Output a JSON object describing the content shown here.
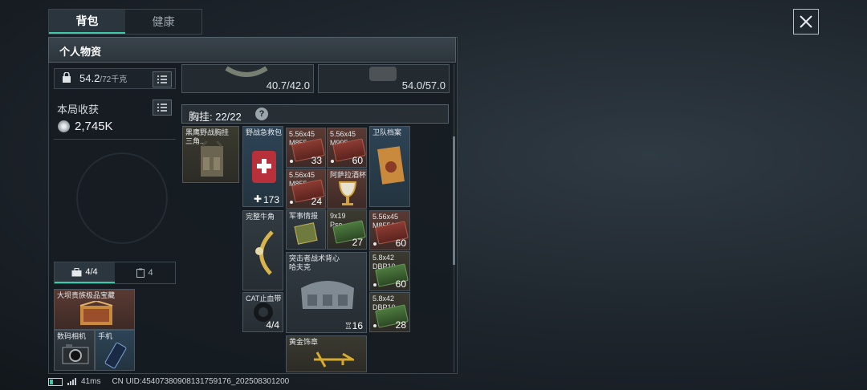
{
  "tabs": [
    {
      "label": "背包",
      "active": true
    },
    {
      "label": "健康",
      "active": false
    }
  ],
  "close_icon": "close-icon",
  "panel": {
    "title": "个人物资"
  },
  "left": {
    "weight_value": "54.2",
    "weight_max": "/72千克",
    "income_label": "本局收获",
    "income_value": "2,745K"
  },
  "bottom_tabs": [
    {
      "label": "4/4",
      "icon": "briefcase-icon",
      "active": true
    },
    {
      "label": "4",
      "icon": "clipboard-icon",
      "active": false
    }
  ],
  "secure_items": [
    {
      "name": "大坝贵族极品宝藏"
    },
    {
      "name": "数码相机"
    },
    {
      "name": "手机"
    }
  ],
  "equipment": [
    {
      "durability": "40.7/42.0"
    },
    {
      "durability": "54.0/57.0"
    }
  ],
  "rig": {
    "title": "胸挂: 22/22",
    "help": "?"
  },
  "items": {
    "rig_item": {
      "name": "黑鹰野战胸挂\n三角..."
    },
    "first_aid": {
      "name": "野战急救包",
      "count": "173"
    },
    "ammo1": {
      "name": "5.56x45\nM855",
      "count": "33"
    },
    "ammo2": {
      "name": "5.56x45\nM995",
      "count": "60"
    },
    "ammo3": {
      "name": "5.56x45\nM855",
      "count": "24"
    },
    "goblet": {
      "name": "阿萨拉酒杯"
    },
    "files": {
      "name": "卫队档案"
    },
    "horn": {
      "name": "完整牛角"
    },
    "intel": {
      "name": "军事情报"
    },
    "ammo9mm": {
      "name": "9x19\nPso",
      "count": "27"
    },
    "ammo4": {
      "name": "5.56x45\nM855A1",
      "count": "60"
    },
    "vest": {
      "name": "突击者战术背心\n哈夫克",
      "count": "16"
    },
    "ammo5": {
      "name": "5.8x42\nDBP10",
      "count": "60"
    },
    "tourniquet": {
      "name": "CAT止血带",
      "count": "4/4"
    },
    "ammo6": {
      "name": "5.8x42\nDBP10",
      "count": "28"
    },
    "badge": {
      "name": "黄金饰章"
    }
  },
  "status": {
    "ping": "41ms",
    "uid": "CN UID:454073809081317591​76_202508301200"
  },
  "colors": {
    "accent": "#3fc9a9",
    "panel": "#161c22"
  }
}
